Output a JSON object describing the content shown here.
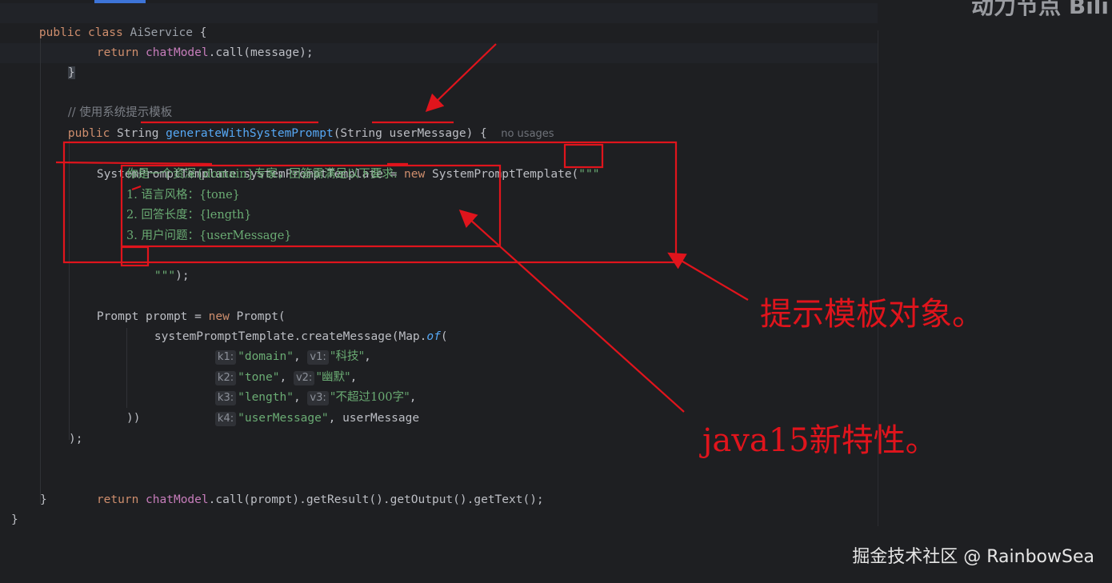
{
  "code": {
    "kw_public": "public",
    "kw_class": "class",
    "class_name": "AiService",
    "open_brace": " {",
    "kw_return": "return",
    "chat_model": "chatModel",
    "call_message": ".call(message);",
    "close_brace": "}",
    "comment": "// 使用系统提示模板",
    "type_string": "String",
    "method_name": "generateWithSystemPrompt",
    "param_open": "(String ",
    "param_name": "userMessage",
    "param_close": ") {",
    "usage_hint": "no usages",
    "template_decl": "SystemPromptTemplate systemPromptTemplate = ",
    "kw_new": "new",
    "template_ctor": " SystemPromptTemplate(",
    "triple_quote": "\"\"\"",
    "tb_line1": "你是一个资深{domain}专家，回答需满足以下要求:",
    "tb_line2": "1. 语言风格：{tone}",
    "tb_line3": "2. 回答长度：{length}",
    "tb_line4": "3. 用户问题：{userMessage}",
    "tb_end_quote": "\"\"\"",
    "tb_end_rest": ");",
    "prompt_decl": "Prompt prompt = ",
    "prompt_ctor": " Prompt(",
    "create_msg": "systemPromptTemplate.createMessage(Map.",
    "of_fn": "of",
    "paren_open": "(",
    "map_entries": [
      {
        "k": "k1:",
        "key": "\"domain\"",
        "v": "v1:",
        "val": "\"科技\"",
        "tail": ","
      },
      {
        "k": "k2:",
        "key": "\"tone\"",
        "v": "v2:",
        "val": "\"幽默\"",
        "tail": ","
      },
      {
        "k": "k3:",
        "key": "\"length\"",
        "v": "v3:",
        "val": "\"不超过100字\"",
        "tail": ","
      },
      {
        "k": "k4:",
        "key": "\"userMessage\"",
        "v": "",
        "val": "userMessage",
        "tail": ""
      }
    ],
    "close_parens": "))",
    "close_call": ");",
    "return_tail": ".call(prompt).getResult().getOutput().getText();",
    "comma": ", "
  },
  "annotations": {
    "template_object": "提示模板对象。",
    "java15_feature": "java15新特性。"
  },
  "watermarks": {
    "top_right": "动力节点  Bili",
    "bottom_right": "掘金技术社区 @ RainbowSea"
  },
  "colors": {
    "background": "#1e1f22",
    "keyword": "#cf8e6d",
    "method": "#56a8f5",
    "field": "#c77dbb",
    "string": "#6aab73",
    "annotation_red": "#e0141c"
  }
}
